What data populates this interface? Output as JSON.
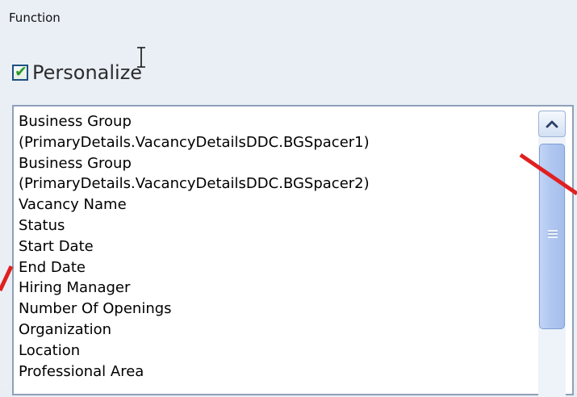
{
  "function_label": "Function",
  "personalize": {
    "label": "Personalize",
    "checked": true
  },
  "list": {
    "items": [
      "Business Group",
      "(PrimaryDetails.VacancyDetailsDDC.BGSpacer1)",
      "Business Group",
      "(PrimaryDetails.VacancyDetailsDDC.BGSpacer2)",
      "Vacancy Name",
      "Status",
      "Start Date",
      "End Date",
      "Hiring Manager",
      "Number Of Openings",
      "Organization",
      "Location",
      "Professional Area"
    ]
  },
  "colors": {
    "annotation_red": "#e02020",
    "checkmark_green": "#2a9a2a",
    "scroll_thumb": "#b1c8f1"
  },
  "icons": {
    "checkbox": "checkmark-icon",
    "scroll_up": "chevron-up-icon",
    "cursor": "text-cursor-icon"
  }
}
